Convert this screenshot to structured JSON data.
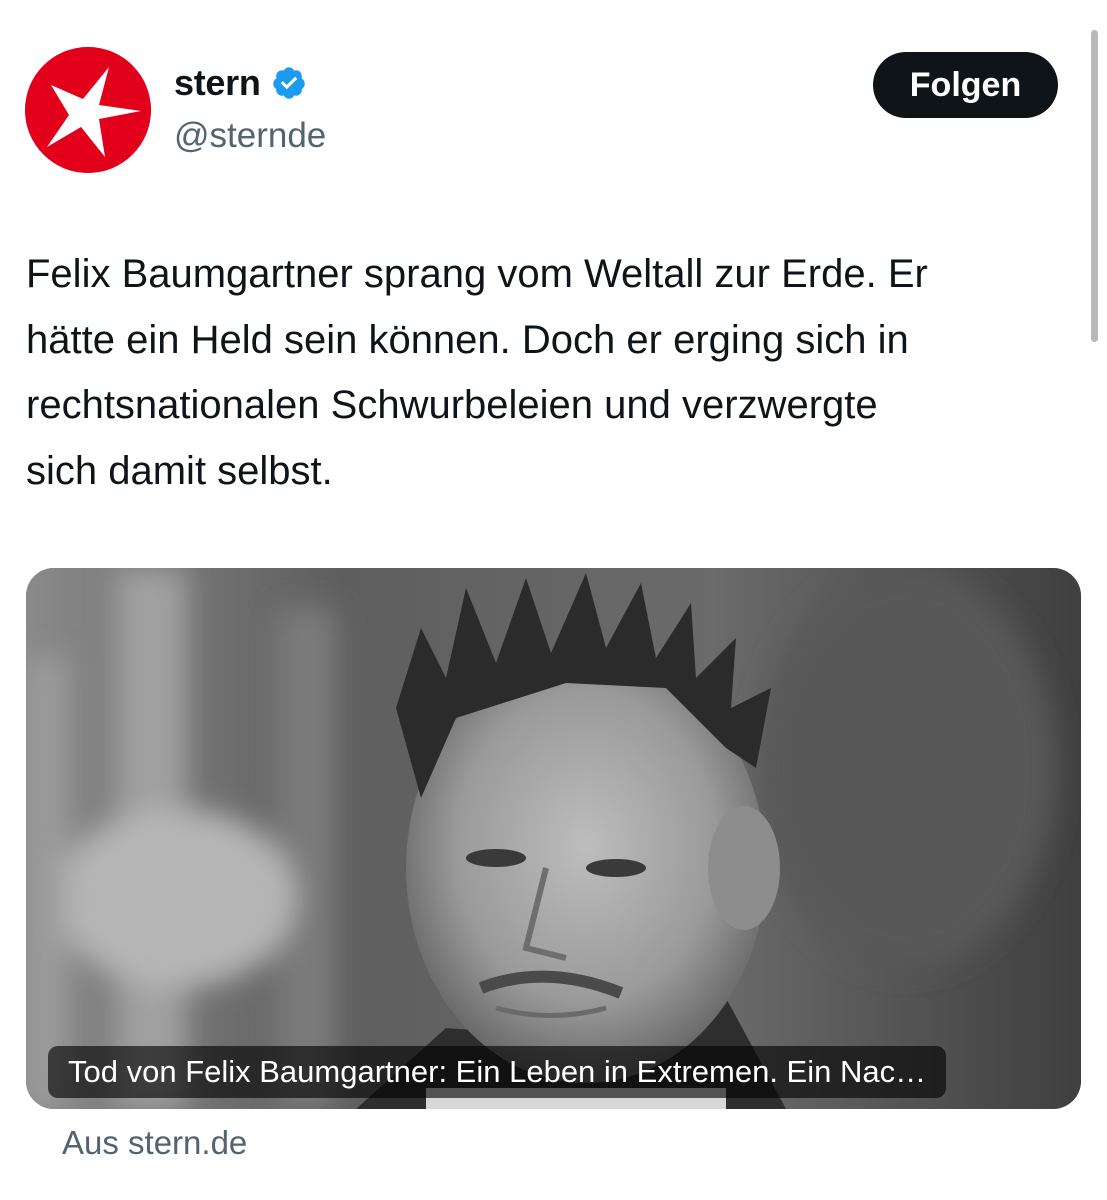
{
  "account": {
    "display_name": "stern",
    "handle": "@sternde",
    "verified": true,
    "avatar_icon": "stern-star-logo",
    "brand_color": "#e3001b",
    "verified_color": "#1d9bf0"
  },
  "follow_button": {
    "label": "Folgen"
  },
  "tweet": {
    "lines": [
      "Felix Baumgartner sprang vom Weltall zur Erde. Er",
      "hätte ein Held sein können. Doch er erging sich in",
      "rechtsnationalen Schwurbeleien und verzwergte",
      "sich damit selbst."
    ]
  },
  "link_card": {
    "image_description_icon": "portrait-photo",
    "caption": "Tod von Felix Baumgartner: Ein Leben in Extremen. Ein Nac…",
    "source": "Aus stern.de"
  }
}
